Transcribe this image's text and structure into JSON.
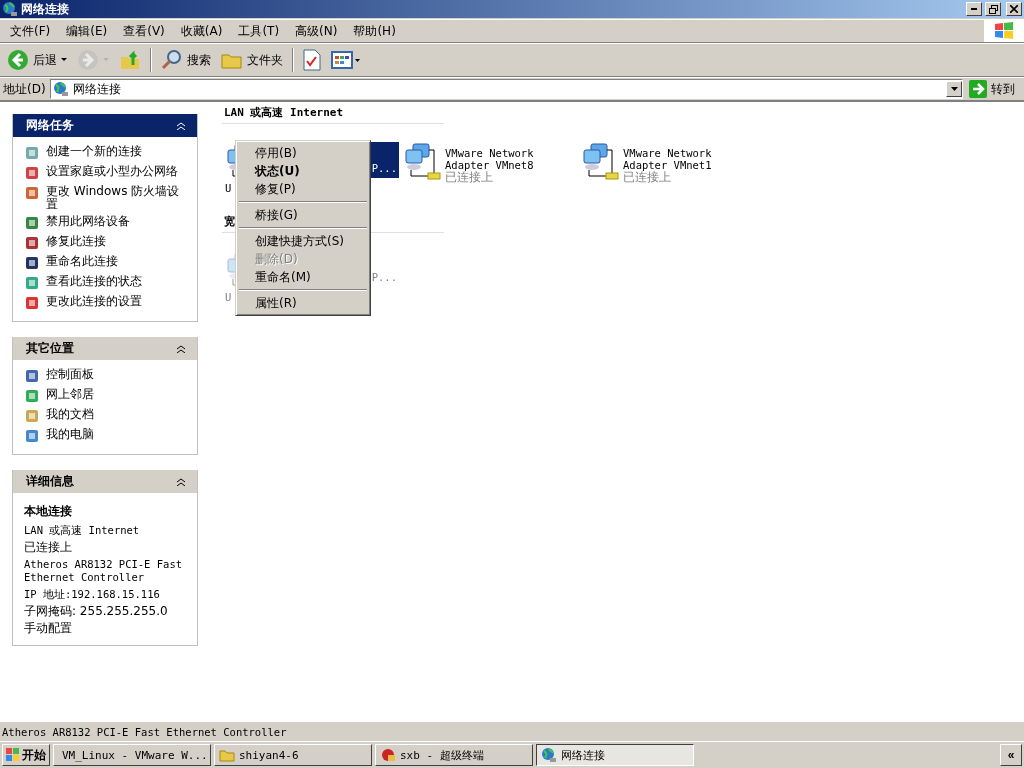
{
  "window": {
    "title": "网络连接"
  },
  "menu": [
    "文件(F)",
    "编辑(E)",
    "查看(V)",
    "收藏(A)",
    "工具(T)",
    "高级(N)",
    "帮助(H)"
  ],
  "toolbar": [
    {
      "kind": "back",
      "label": "后退",
      "disabled": false
    },
    {
      "kind": "forward",
      "disabled": true
    },
    {
      "kind": "up",
      "disabled": false
    },
    {
      "kind": "search",
      "label": "搜索",
      "disabled": false
    },
    {
      "kind": "folders",
      "label": "文件夹",
      "disabled": false
    },
    {
      "kind": "check",
      "disabled": false
    },
    {
      "kind": "views",
      "disabled": false
    }
  ],
  "address": {
    "label": "地址(D)",
    "value": "网络连接",
    "go": "转到"
  },
  "panels": [
    {
      "title": "网络任务",
      "kind": "tasks",
      "items": [
        "创建一个新的连接",
        "设置家庭或小型办公网络",
        "更改 Windows 防火墙设置",
        "禁用此网络设备",
        "修复此连接",
        "重命名此连接",
        "查看此连接的状态",
        "更改此连接的设置"
      ]
    },
    {
      "title": "其它位置",
      "kind": "tasks",
      "items": [
        "控制面板",
        "网上邻居",
        "我的文档",
        "我的电脑"
      ]
    },
    {
      "title": "详细信息",
      "kind": "details",
      "name": "本地连接",
      "lines": [
        "LAN 或高速 Internet",
        "已连接上",
        "Atheros AR8132 PCI-E Fast Ethernet Controller",
        "IP 地址:192.168.15.116",
        "子网掩码: 255.255.255.0",
        "手动配置"
      ]
    }
  ],
  "groups": [
    {
      "title": "LAN 或高速 Internet",
      "items": [
        {
          "kind": "covered",
          "selected": true,
          "disabled": false,
          "fragments": [
            "U",
            "P..."
          ]
        },
        {
          "kind": "full",
          "selected": false,
          "disabled": false,
          "name": "VMware Network Adapter VMnet8",
          "status": "已连接上"
        },
        {
          "kind": "full",
          "selected": false,
          "disabled": false,
          "name": "VMware Network Adapter VMnet1",
          "status": "已连接上"
        }
      ]
    },
    {
      "title": "宽",
      "items": [
        {
          "kind": "covered",
          "selected": false,
          "disabled": true,
          "fragments": [
            "U",
            "P..."
          ]
        }
      ]
    }
  ],
  "context_menu": [
    [
      {
        "label": "停用(B)",
        "default": false,
        "disabled": false
      },
      {
        "label": "状态(U)",
        "default": true,
        "disabled": false
      },
      {
        "label": "修复(P)",
        "default": false,
        "disabled": false
      }
    ],
    [
      {
        "label": "桥接(G)",
        "default": false,
        "disabled": false
      }
    ],
    [
      {
        "label": "创建快捷方式(S)",
        "default": false,
        "disabled": false
      },
      {
        "label": "删除(D)",
        "default": false,
        "disabled": true
      },
      {
        "label": "重命名(M)",
        "default": false,
        "disabled": false
      }
    ],
    [
      {
        "label": "属性(R)",
        "default": false,
        "disabled": false
      }
    ]
  ],
  "status_bar": "Atheros AR8132 PCI-E Fast Ethernet Controller",
  "taskbar": {
    "start": "开始",
    "tasks": [
      {
        "label": "VM_Linux - VMware W...",
        "selected": false
      },
      {
        "label": "shiyan4-6",
        "selected": false
      },
      {
        "label": "sxb - 超级终端",
        "selected": false
      },
      {
        "label": "网络连接",
        "selected": true
      }
    ],
    "tray": "«"
  }
}
